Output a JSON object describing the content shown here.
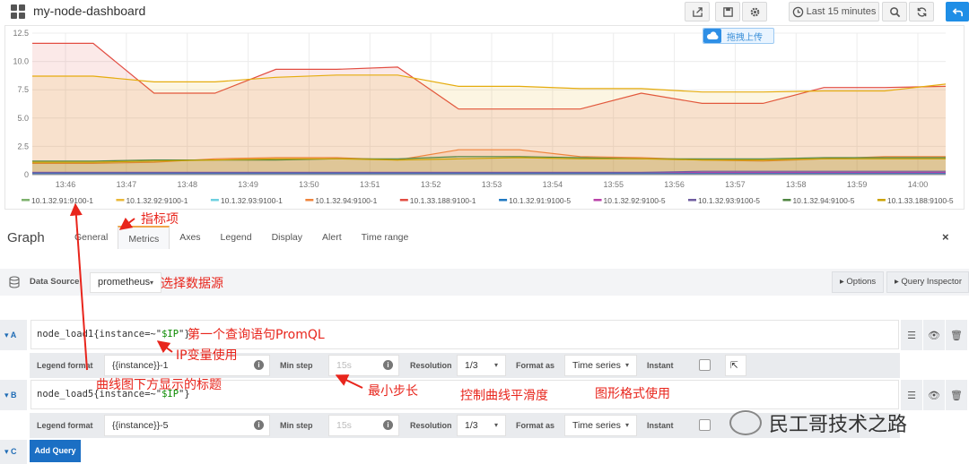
{
  "header": {
    "title": "my-node-dashboard",
    "time_range": "Last 15 minutes",
    "icons": [
      "dashboard-grid-icon",
      "share-icon",
      "save-icon",
      "settings-icon",
      "clock-icon",
      "zoom-out-icon",
      "refresh-icon",
      "back-icon"
    ]
  },
  "upload_badge": "拖拽上传",
  "chart_data": {
    "type": "area",
    "x": [
      "13:46",
      "13:47",
      "13:48",
      "13:49",
      "13:50",
      "13:51",
      "13:52",
      "13:53",
      "13:54",
      "13:55",
      "13:56",
      "13:57",
      "13:58",
      "13:59",
      "14:00"
    ],
    "ylim": [
      0,
      12.5
    ],
    "yticks": [
      "0",
      "2.5",
      "5.0",
      "7.5",
      "10.0",
      "12.5"
    ],
    "grid": true,
    "legend_position": "bottom",
    "series": [
      {
        "name": "10.1.33.188:9100-1",
        "color": "#e24d42",
        "values": [
          11.6,
          11.6,
          7.2,
          7.2,
          9.3,
          9.3,
          9.5,
          5.8,
          5.8,
          5.8,
          7.2,
          6.3,
          6.3,
          7.7,
          7.7,
          7.8
        ]
      },
      {
        "name": "10.1.32.92:9100-1",
        "color": "#e5ac0e",
        "values": [
          8.7,
          8.7,
          8.2,
          8.2,
          8.6,
          8.8,
          8.8,
          7.8,
          7.8,
          7.6,
          7.6,
          7.3,
          7.3,
          7.4,
          7.4,
          8.0
        ]
      },
      {
        "name": "10.1.32.94:9100-1",
        "color": "#ef843c",
        "values": [
          1.0,
          1.0,
          1.1,
          1.4,
          1.5,
          1.5,
          1.3,
          2.2,
          2.2,
          1.6,
          1.5,
          1.3,
          1.2,
          1.4,
          1.6,
          1.6
        ]
      },
      {
        "name": "10.1.32.94:9100-5",
        "color": "#508642",
        "values": [
          1.2,
          1.2,
          1.3,
          1.3,
          1.3,
          1.4,
          1.4,
          1.6,
          1.6,
          1.5,
          1.4,
          1.4,
          1.4,
          1.5,
          1.5,
          1.5
        ]
      },
      {
        "name": "10.1.33.188:9100-5",
        "color": "#cca300",
        "values": [
          1.1,
          1.1,
          1.2,
          1.3,
          1.4,
          1.4,
          1.3,
          1.4,
          1.5,
          1.4,
          1.4,
          1.3,
          1.3,
          1.4,
          1.4,
          1.4
        ]
      },
      {
        "name": "10.1.32.91:9100-1",
        "color": "#7eb26d",
        "values": [
          0.1,
          0.1,
          0.1,
          0.1,
          0.1,
          0.1,
          0.1,
          0.1,
          0.1,
          0.1,
          0.1,
          0.1,
          0.1,
          0.1,
          0.1,
          0.1
        ]
      },
      {
        "name": "10.1.32.93:9100-1",
        "color": "#6ed0e0",
        "values": [
          0.15,
          0.15,
          0.15,
          0.15,
          0.15,
          0.15,
          0.15,
          0.15,
          0.15,
          0.15,
          0.15,
          0.15,
          0.15,
          0.15,
          0.15,
          0.15
        ]
      },
      {
        "name": "10.1.32.91:9100-5",
        "color": "#1f78c1",
        "values": [
          0.1,
          0.1,
          0.1,
          0.1,
          0.1,
          0.1,
          0.1,
          0.1,
          0.1,
          0.1,
          0.1,
          0.1,
          0.1,
          0.1,
          0.1,
          0.1
        ]
      },
      {
        "name": "10.1.32.92:9100-5",
        "color": "#ba43a9",
        "values": [
          0.2,
          0.2,
          0.2,
          0.2,
          0.2,
          0.2,
          0.2,
          0.2,
          0.2,
          0.2,
          0.2,
          0.2,
          0.2,
          0.2,
          0.2,
          0.2
        ]
      },
      {
        "name": "10.1.32.93:9100-5",
        "color": "#705da0",
        "values": [
          0.2,
          0.2,
          0.2,
          0.2,
          0.2,
          0.2,
          0.2,
          0.2,
          0.2,
          0.2,
          0.2,
          0.3,
          0.3,
          0.3,
          0.3,
          0.3
        ]
      }
    ],
    "legend": [
      {
        "name": "10.1.32.91:9100-1",
        "color": "#7eb26d"
      },
      {
        "name": "10.1.32.92:9100-1",
        "color": "#eab839"
      },
      {
        "name": "10.1.32.93:9100-1",
        "color": "#6ed0e0"
      },
      {
        "name": "10.1.32.94:9100-1",
        "color": "#ef843c"
      },
      {
        "name": "10.1.33.188:9100-1",
        "color": "#e24d42"
      },
      {
        "name": "10.1.32.91:9100-5",
        "color": "#1f78c1"
      },
      {
        "name": "10.1.32.92:9100-5",
        "color": "#ba43a9"
      },
      {
        "name": "10.1.32.93:9100-5",
        "color": "#705da0"
      },
      {
        "name": "10.1.32.94:9100-5",
        "color": "#508642"
      },
      {
        "name": "10.1.33.188:9100-5",
        "color": "#cca300"
      }
    ]
  },
  "editor": {
    "panel_title": "Graph",
    "tabs": [
      "General",
      "Metrics",
      "Axes",
      "Legend",
      "Display",
      "Alert",
      "Time range"
    ],
    "active_tab": "Metrics",
    "close_icon": "×",
    "data_source_label": "Data Source",
    "data_source_value": "prometheus",
    "options_label": "Options",
    "query_inspector_label": "Query Inspector",
    "queries": [
      {
        "letter": "A",
        "expr_prefix": "node_load1{instance=~\"",
        "expr_var": "$IP",
        "expr_suffix": "\"}",
        "legend_format_label": "Legend format",
        "legend_format_value": "{{instance}}-1",
        "min_step_label": "Min step",
        "min_step_placeholder": "15s",
        "resolution_label": "Resolution",
        "resolution_value": "1/3",
        "format_as_label": "Format as",
        "format_as_value": "Time series",
        "instant_label": "Instant"
      },
      {
        "letter": "B",
        "expr_prefix": "node_load5{instance=~\"",
        "expr_var": "$IP",
        "expr_suffix": "\"}",
        "legend_format_label": "Legend format",
        "legend_format_value": "{{instance}}-5",
        "min_step_label": "Min step",
        "min_step_placeholder": "15s",
        "resolution_label": "Resolution",
        "resolution_value": "1/3",
        "format_as_label": "Format as",
        "format_as_value": "Time series",
        "instant_label": "Instant"
      }
    ],
    "next_letter": "C",
    "add_query_label": "Add Query"
  },
  "annotations": {
    "metrics_tab": "指标项",
    "data_source": "选择数据源",
    "first_query": "第一个查询语句PromQL",
    "ip_variable": "IP变量使用",
    "legend_title": "曲线图下方显示的标题",
    "min_step": "最小步长",
    "smoothness": "控制曲线平滑度",
    "format": "图形格式使用",
    "color": "#e8251c"
  },
  "watermark": "民工哥技术之路"
}
